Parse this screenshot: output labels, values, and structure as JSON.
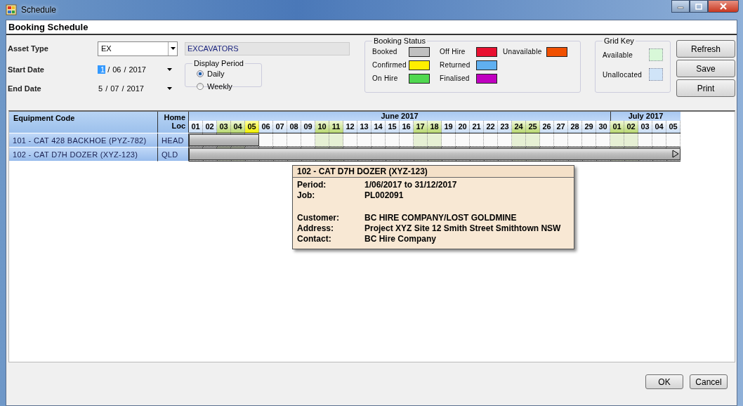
{
  "window": {
    "title": "Schedule"
  },
  "header": {
    "title": "Booking Schedule"
  },
  "form": {
    "asset_type": {
      "label": "Asset Type",
      "code": "EX",
      "description": "EXCAVATORS"
    },
    "start_date": {
      "label": "Start Date",
      "separator": "/",
      "parts": [
        {
          "text": "1",
          "selected": true
        },
        {
          "text": "06",
          "selected": false
        },
        {
          "text": "2017",
          "selected": false
        }
      ]
    },
    "end_date": {
      "label": "End Date",
      "separator": "/",
      "parts": [
        {
          "text": "5",
          "selected": false
        },
        {
          "text": "07",
          "selected": false
        },
        {
          "text": "2017",
          "selected": false
        }
      ]
    },
    "display_period": {
      "title": "Display Period",
      "options": [
        {
          "label": "Daily",
          "selected": true
        },
        {
          "label": "Weekly",
          "selected": false
        }
      ]
    }
  },
  "booking_status": {
    "title": "Booking Status",
    "items": [
      {
        "label": "Booked",
        "color": "#c0c0c0"
      },
      {
        "label": "Confirmed",
        "color": "#ffee00"
      },
      {
        "label": "On Hire",
        "color": "#50d850"
      },
      {
        "label": "Off Hire",
        "color": "#e81030"
      },
      {
        "label": "Returned",
        "color": "#60b0f0"
      },
      {
        "label": "Finalised",
        "color": "#c000c0"
      },
      {
        "label": "Unavailable",
        "color": "#f05000"
      }
    ]
  },
  "grid_key": {
    "title": "Grid Key",
    "items": [
      {
        "label": "Available",
        "color": "#d8f8d8"
      },
      {
        "label": "Unallocated",
        "color": "#d0e4f8"
      }
    ]
  },
  "side_buttons": [
    "Refresh",
    "Save",
    "Print"
  ],
  "schedule": {
    "columns": [
      "Equipment Code",
      "Home Loc"
    ],
    "months": [
      {
        "label": "June 2017",
        "days": [
          {
            "label": "01",
            "weekend": false,
            "today": false
          },
          {
            "label": "02",
            "weekend": false,
            "today": false
          },
          {
            "label": "03",
            "weekend": true,
            "today": false
          },
          {
            "label": "04",
            "weekend": true,
            "today": false
          },
          {
            "label": "05",
            "weekend": false,
            "today": true
          },
          {
            "label": "06",
            "weekend": false,
            "today": false
          },
          {
            "label": "07",
            "weekend": false,
            "today": false
          },
          {
            "label": "08",
            "weekend": false,
            "today": false
          },
          {
            "label": "09",
            "weekend": false,
            "today": false
          },
          {
            "label": "10",
            "weekend": true,
            "today": false
          },
          {
            "label": "11",
            "weekend": true,
            "today": false
          },
          {
            "label": "12",
            "weekend": false,
            "today": false
          },
          {
            "label": "13",
            "weekend": false,
            "today": false
          },
          {
            "label": "14",
            "weekend": false,
            "today": false
          },
          {
            "label": "15",
            "weekend": false,
            "today": false
          },
          {
            "label": "16",
            "weekend": false,
            "today": false
          },
          {
            "label": "17",
            "weekend": true,
            "today": false
          },
          {
            "label": "18",
            "weekend": true,
            "today": false
          },
          {
            "label": "19",
            "weekend": false,
            "today": false
          },
          {
            "label": "20",
            "weekend": false,
            "today": false
          },
          {
            "label": "21",
            "weekend": false,
            "today": false
          },
          {
            "label": "22",
            "weekend": false,
            "today": false
          },
          {
            "label": "23",
            "weekend": false,
            "today": false
          },
          {
            "label": "24",
            "weekend": true,
            "today": false
          },
          {
            "label": "25",
            "weekend": true,
            "today": false
          },
          {
            "label": "26",
            "weekend": false,
            "today": false
          },
          {
            "label": "27",
            "weekend": false,
            "today": false
          },
          {
            "label": "28",
            "weekend": false,
            "today": false
          },
          {
            "label": "29",
            "weekend": false,
            "today": false
          },
          {
            "label": "30",
            "weekend": false,
            "today": false
          }
        ]
      },
      {
        "label": "July 2017",
        "days": [
          {
            "label": "01",
            "weekend": true,
            "today": false
          },
          {
            "label": "02",
            "weekend": true,
            "today": false
          },
          {
            "label": "03",
            "weekend": false,
            "today": false
          },
          {
            "label": "04",
            "weekend": false,
            "today": false
          },
          {
            "label": "05",
            "weekend": false,
            "today": false
          }
        ]
      }
    ],
    "rows": [
      {
        "equipment": "101 - CAT 428 BACKHOE (PYZ-782)",
        "home_loc": "HEAD",
        "booking": {
          "color": "#c0c0c0",
          "level": 0.142857,
          "continues": false
        }
      },
      {
        "equipment": "102 - CAT D7H DOZER (XYZ-123)",
        "home_loc": "QLD",
        "booking": {
          "color": "#c0c0c0",
          "level": 1,
          "continues": true
        }
      }
    ]
  },
  "tooltip": {
    "title": "102 - CAT D7H DOZER (XYZ-123)",
    "groups": [
      [
        {
          "label": "Period:",
          "value": "1/06/2017 to 31/12/2017"
        },
        {
          "label": "Job:",
          "value": "PL002091"
        }
      ],
      [
        {
          "label": "Customer:",
          "value": "BC HIRE COMPANY/LOST GOLDMINE"
        },
        {
          "label": "Address:",
          "value": "Project XYZ Site 12 Smith Street Smithtown  NSW"
        },
        {
          "label": "Contact:",
          "value": " BC Hire Company"
        }
      ]
    ]
  },
  "footer_buttons": [
    "OK",
    "Cancel"
  ]
}
